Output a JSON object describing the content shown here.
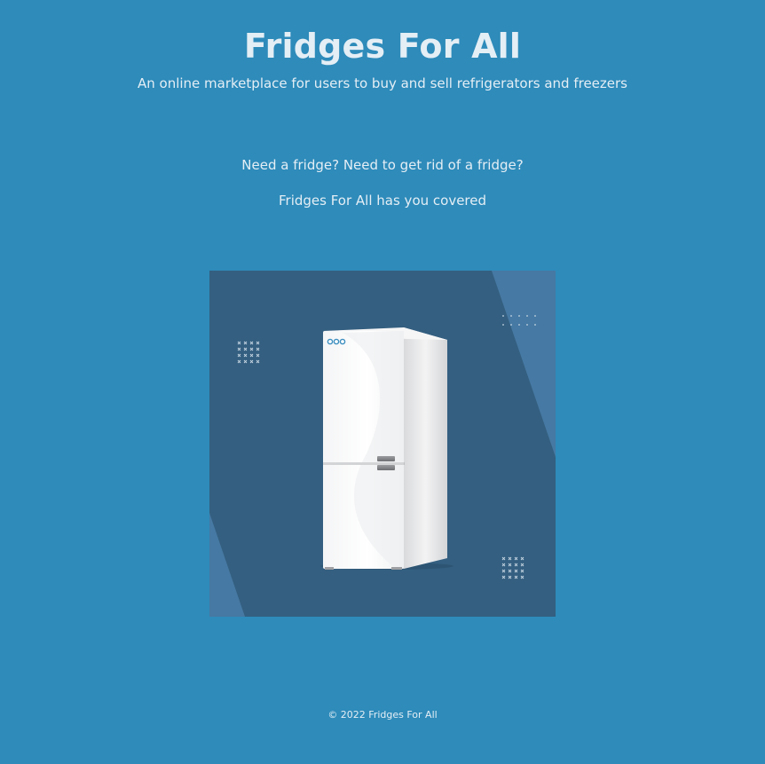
{
  "header": {
    "title": "Fridges For All",
    "tagline": "An online marketplace for users to buy and sell refrigerators and freezers"
  },
  "intro": {
    "line1": "Need a fridge? Need to get rid of a fridge?",
    "line2": "Fridges For All has you covered"
  },
  "hero": {
    "image_subject": "fridge-illustration",
    "background_color": "#345f80",
    "accent_color": "#4679a3"
  },
  "footer": {
    "copyright": "© 2022 Fridges For All"
  },
  "colors": {
    "page_background": "#2e8bba",
    "text": "#e4eef5"
  }
}
